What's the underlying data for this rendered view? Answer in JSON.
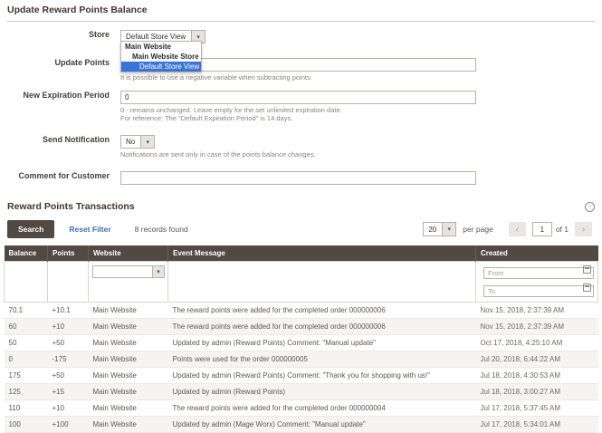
{
  "colors": {
    "accent_blue": "#3875d7",
    "grid_header_bg": "#514943",
    "link_blue": "#3b73af",
    "search_button_bg": "#514943"
  },
  "icons": {
    "caret_down": "▾",
    "chevron_left": "‹",
    "chevron_right": "›",
    "collapse": "−"
  },
  "form": {
    "title": "Update Reward Points Balance",
    "fields": {
      "store": {
        "label": "Store",
        "value": "Default Store View",
        "options": [
          "Main Website",
          "Main Website Store",
          "Default Store View"
        ]
      },
      "update_points": {
        "label": "Update Points",
        "value": "",
        "note": "It is possible to use a negative variable when subtracting points."
      },
      "new_expiration_period": {
        "label": "New Expiration Period",
        "value": "0",
        "note1": "0 - remains unchanged. Leave empty for the set unlimited expiration date.",
        "note2": "For reference: The \"Default Expiration Period\" is 14 days."
      },
      "send_notification": {
        "label": "Send Notification",
        "value": "No",
        "note": "Notifications are sent only in case of the points balance changes."
      },
      "comment": {
        "label": "Comment for Customer",
        "value": ""
      }
    }
  },
  "transactions": {
    "title": "Reward Points Transactions",
    "search_label": "Search",
    "reset_label": "Reset Filter",
    "records_text": "8 records found",
    "pagination": {
      "per_page": "20",
      "per_page_label": "per page",
      "page": "1",
      "of_label": "of 1"
    },
    "columns": [
      "Balance",
      "Points",
      "Website",
      "Event Message",
      "Created"
    ],
    "filters": {
      "from_placeholder": "From",
      "to_placeholder": "To"
    },
    "rows": [
      {
        "balance": "70.1",
        "points": "+10.1",
        "website": "Main Website",
        "message": "The reward points were added for the completed order 000000006",
        "created": "Nov 15, 2018, 2:37:39 AM"
      },
      {
        "balance": "60",
        "points": "+10",
        "website": "Main Website",
        "message": "The reward points were added for the completed order 000000006",
        "created": "Nov 15, 2018, 2:37:39 AM"
      },
      {
        "balance": "50",
        "points": "+50",
        "website": "Main Website",
        "message": "Updated by admin (Reward Points) Comment: \"Manual update\"",
        "created": "Oct 17, 2018, 4:25:10 AM"
      },
      {
        "balance": "0",
        "points": "-175",
        "website": "Main Website",
        "message": "Points were used for the order 000000005",
        "created": "Jul 20, 2018, 6:44:22 AM"
      },
      {
        "balance": "175",
        "points": "+50",
        "website": "Main Website",
        "message": "Updated by admin (Reward Points) Comment: \"Thank you for shopping with us!\"",
        "created": "Jul 18, 2018, 4:30:53 AM"
      },
      {
        "balance": "125",
        "points": "+15",
        "website": "Main Website",
        "message": "Updated by admin (Reward Points)",
        "created": "Jul 18, 2018, 3:00:27 AM"
      },
      {
        "balance": "110",
        "points": "+10",
        "website": "Main Website",
        "message": "The reward points were added for the completed order 000000004",
        "created": "Jul 17, 2018, 5:37:45 AM"
      },
      {
        "balance": "100",
        "points": "+100",
        "website": "Main Website",
        "message": "Updated by admin (Mage Worx) Comment: \"Manual update\"",
        "created": "Jul 17, 2018, 5:34:01 AM"
      }
    ]
  }
}
